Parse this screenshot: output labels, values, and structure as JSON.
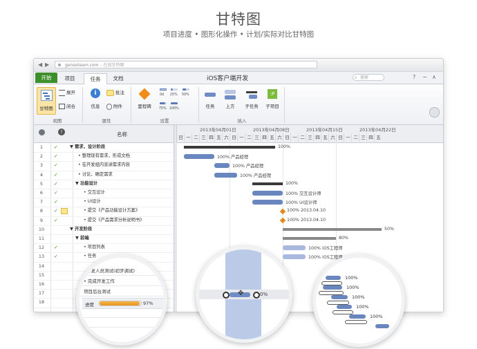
{
  "hero": {
    "title": "甘特图",
    "subtitle": "项目进度 • 图形化操作 • 计划/实际对比甘特图"
  },
  "browser": {
    "back": "◀",
    "forward": "▶",
    "url": "genseteam.com",
    "url_hint": "- 在线甘特图"
  },
  "ribbon_tabs": {
    "start": "开始",
    "project": "项目",
    "task": "任务",
    "doc": "文档"
  },
  "app_title": "iOS客户端开发",
  "search": {
    "placeholder": "搜索",
    "icon": "search-icon"
  },
  "window_controls": {
    "help": "?",
    "minimize": "−",
    "collapse": "∧"
  },
  "ribbon": {
    "view_group": {
      "label": "视图",
      "gantt": "甘特图",
      "expand": "展开",
      "collapse": "闭合"
    },
    "attr_group": {
      "label": "属性",
      "info": "信息",
      "comment": "批注",
      "attach": "附件"
    },
    "settings_group": {
      "label": "设置",
      "milestone": "里程碑",
      "d0": "0d",
      "d25": "25%",
      "d50": "50%",
      "d75": "75%",
      "d100": "100%"
    },
    "insert_group": {
      "label": "插入",
      "task": "任务",
      "above": "上方",
      "subtask": "子任务",
      "subproject": "子项目",
      "subproject_icon_text": ":P"
    }
  },
  "table": {
    "header_name": "名称",
    "header_info_icon": "!",
    "weeks": [
      "2013年04月01日",
      "2013年04月08日",
      "2013年04月15日",
      "2013年04月22日"
    ],
    "days": [
      "日",
      "一",
      "二",
      "三",
      "四",
      "五",
      "六",
      "日",
      "一",
      "二",
      "三",
      "四",
      "五",
      "六",
      "日",
      "一",
      "二",
      "三",
      "四",
      "五",
      "六",
      "日",
      "一",
      "二",
      "三",
      "四",
      "五"
    ],
    "rows": [
      {
        "num": "1",
        "check": "✓",
        "name": "▼ 需求，设计阶段",
        "label": "100%"
      },
      {
        "num": "2",
        "check": "✓",
        "name": "• 整理现有需求，形成文档",
        "label": "100%  产品经理"
      },
      {
        "num": "3",
        "check": "✓",
        "name": "• 在开发组内宣讲需求内容",
        "label": "100%  产品经理"
      },
      {
        "num": "4",
        "check": "✓",
        "name": "• 讨论，确定需求",
        "label": "100%  产品经理"
      },
      {
        "num": "5",
        "check": "✓",
        "name": "▼ 功能设计",
        "label": "100%"
      },
      {
        "num": "6",
        "check": "✓",
        "name": "• 交互设计",
        "label": "100%  交互设计师"
      },
      {
        "num": "7",
        "check": "✓",
        "name": "• UI设计",
        "label": "100%  UI设计师"
      },
      {
        "num": "8",
        "check": "✓",
        "name": "• 提交《产品功能设计方案》",
        "label": "100%  2013.04.10"
      },
      {
        "num": "9",
        "check": "✓",
        "name": "• 提交《产品需求分析说明书》",
        "label": "100%  2013.04.10"
      },
      {
        "num": "10",
        "check": "",
        "name": "▼ 开发阶段",
        "label": "50%"
      },
      {
        "num": "11",
        "check": "",
        "name": "▼ 前端",
        "label": "80%"
      },
      {
        "num": "12",
        "check": "✓",
        "name": "• 项目列表",
        "label": "100%  iOS工程师"
      },
      {
        "num": "13",
        "check": "✓",
        "name": "• 任务",
        "label": "100%  iOS工程师"
      },
      {
        "num": "14",
        "check": "",
        "name": "",
        "label": ""
      },
      {
        "num": "15",
        "check": "",
        "name": "",
        "label": ""
      },
      {
        "num": "16",
        "check": "",
        "name": "",
        "label": ""
      },
      {
        "num": "17",
        "check": "",
        "name": "",
        "label": ""
      },
      {
        "num": "18",
        "check": "",
        "name": "",
        "label": ""
      }
    ]
  },
  "magnifier1": {
    "line1": "开发人员测试(初步调试)",
    "line2": "• 完成开发工作",
    "line3": "项目后台测试",
    "progress_label": "进度",
    "progress_value": "97%",
    "progress_fraction": 0.97
  },
  "magnifier2": {
    "percent": "0%"
  },
  "magnifier3": {
    "labels": [
      "100%",
      "100%",
      "100%",
      "100%",
      "100%"
    ]
  }
}
